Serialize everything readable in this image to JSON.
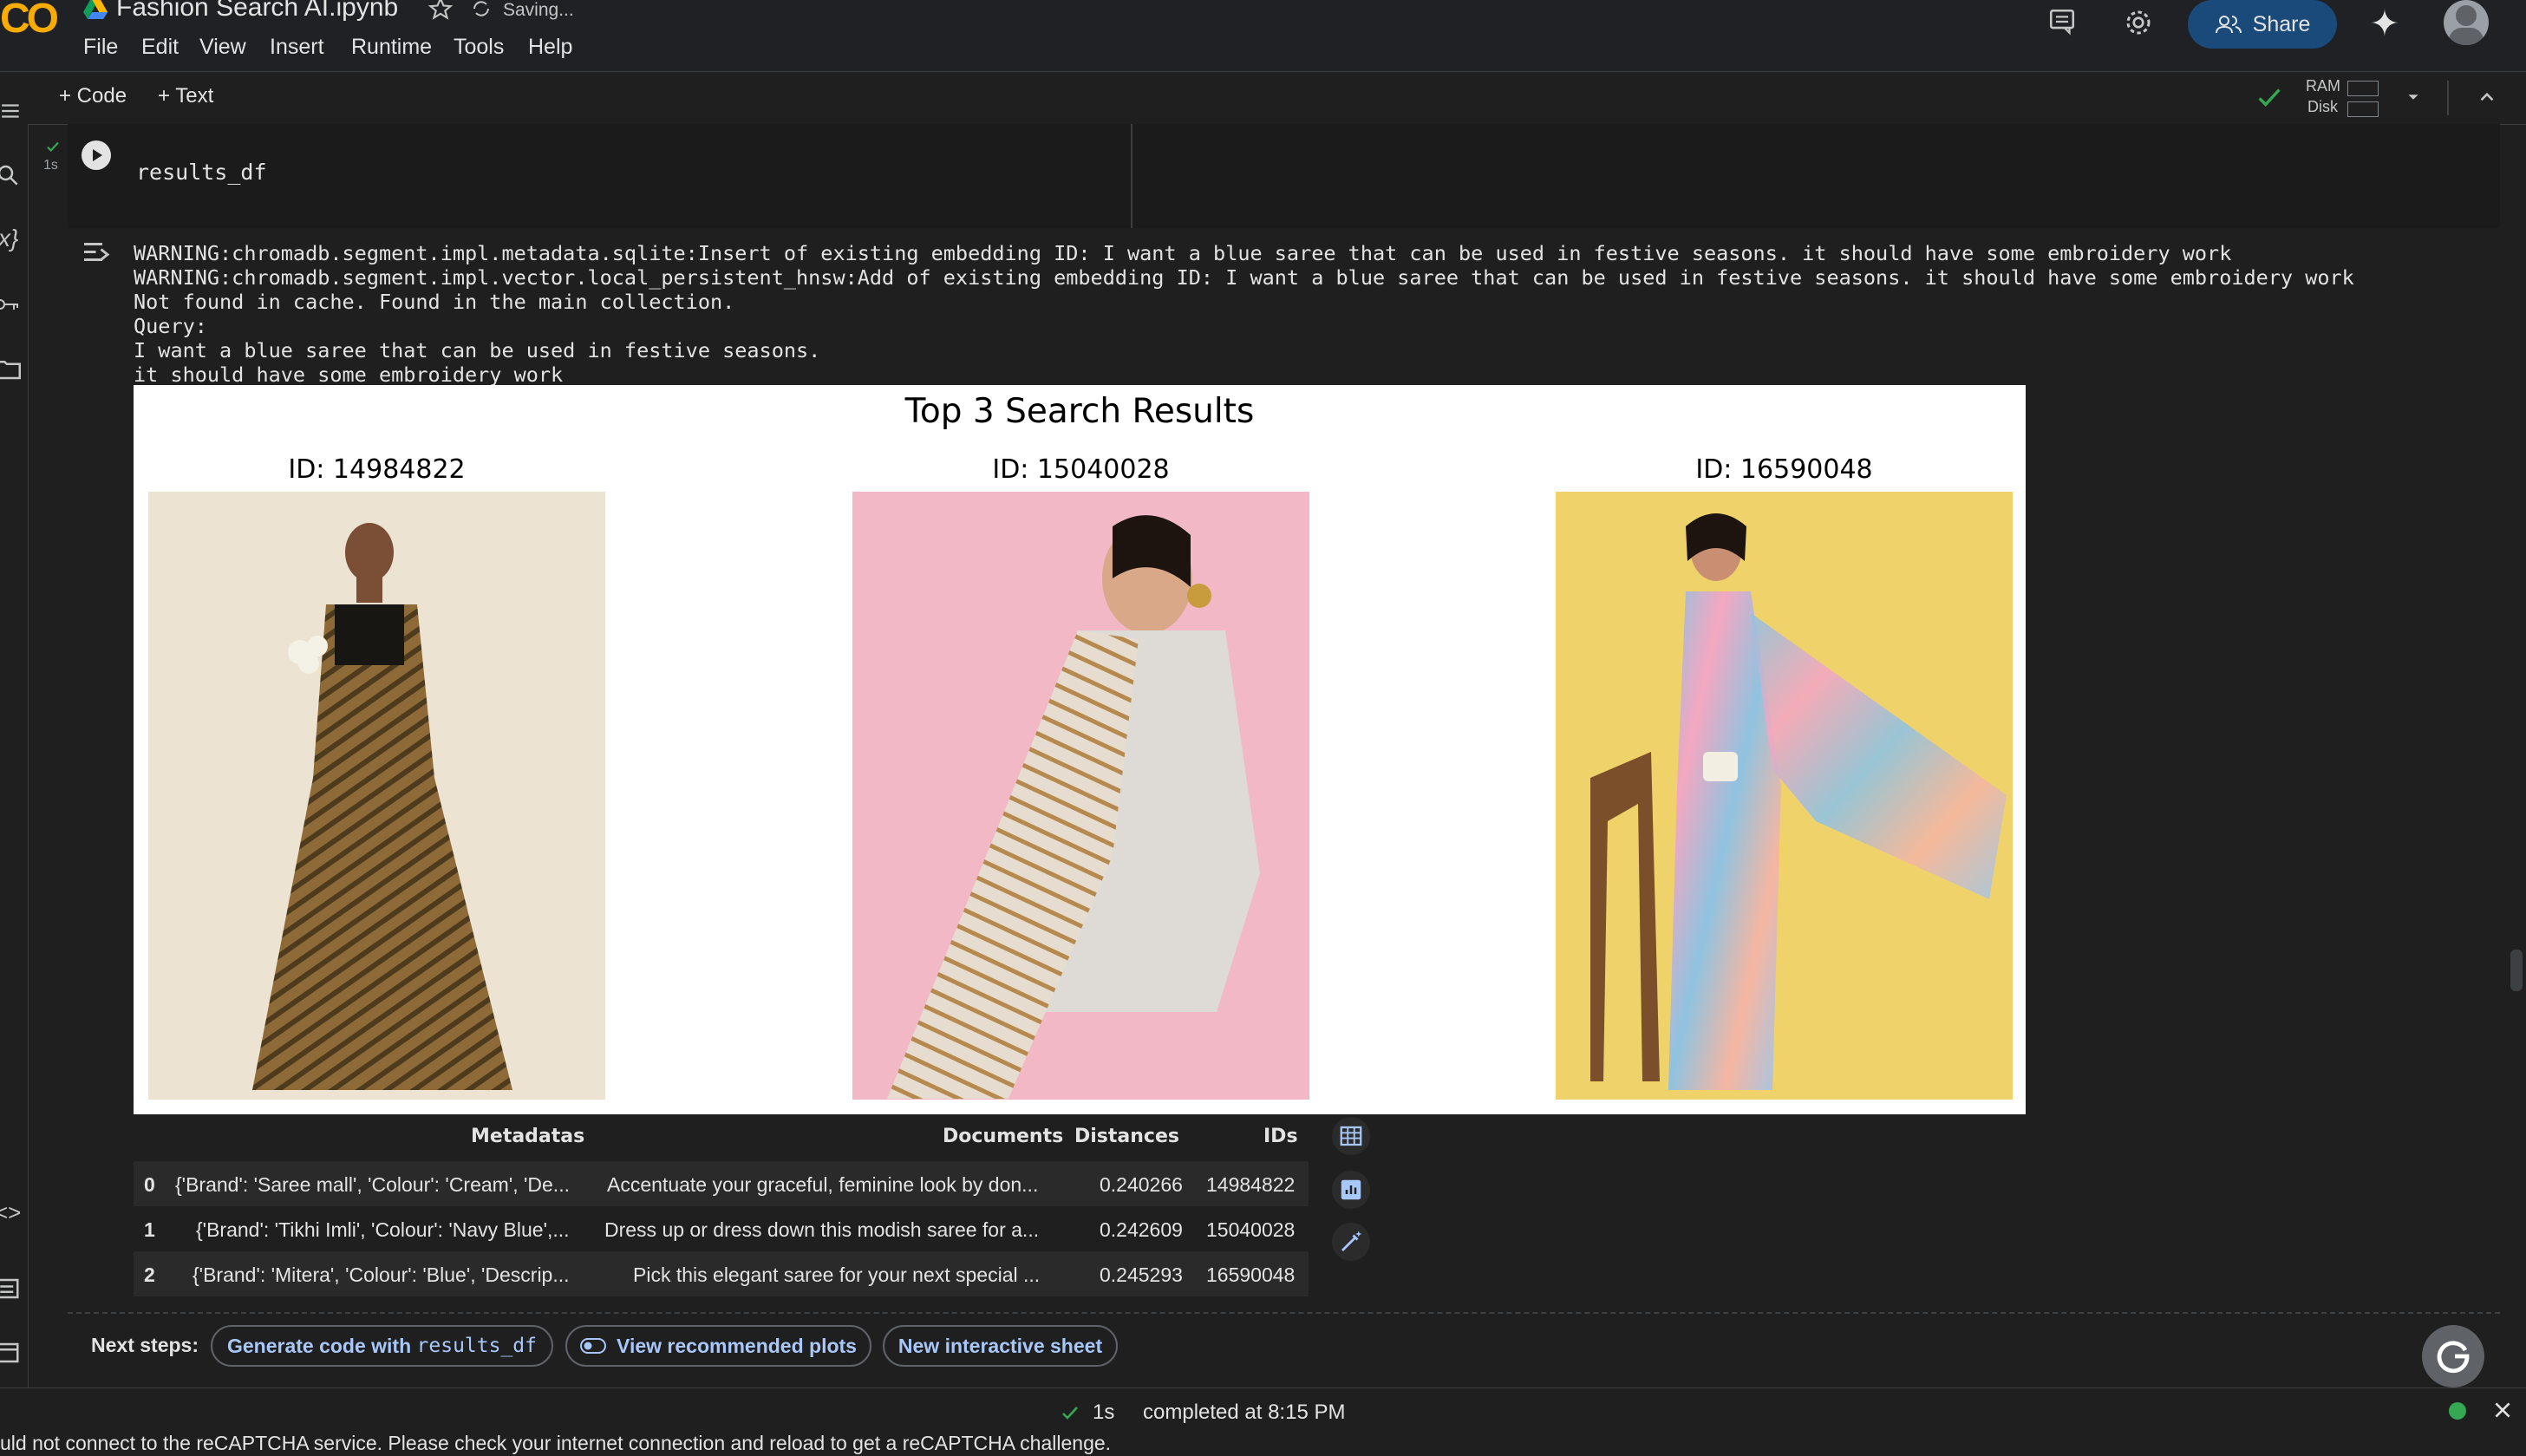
{
  "app": {
    "logo_text": "CO",
    "notebook_title": "Fashion Search AI.ipynb",
    "save_status": "Saving...",
    "menu": [
      "File",
      "Edit",
      "View",
      "Insert",
      "Runtime",
      "Tools",
      "Help"
    ],
    "share_label": "Share"
  },
  "toolbar": {
    "add_code": "+ Code",
    "add_text": "+ Text",
    "ram_label": "RAM",
    "disk_label": "Disk"
  },
  "cell": {
    "exec_time": "1s",
    "code": "results_df"
  },
  "output": {
    "lines": [
      "WARNING:chromadb.segment.impl.metadata.sqlite:Insert of existing embedding ID: I want a blue saree that can be used in festive seasons. it should have some embroidery work",
      "WARNING:chromadb.segment.impl.vector.local_persistent_hnsw:Add of existing embedding ID: I want a blue saree that can be used in festive seasons. it should have some embroidery work",
      "Not found in cache. Found in the main collection.",
      "Query:",
      "I want a blue saree that can be used in festive seasons.",
      "it should have some embroidery work"
    ]
  },
  "figure": {
    "title": "Top 3 Search Results",
    "items": [
      {
        "label": "ID: 14984822",
        "bg": "#ece3d2",
        "saree": "#8d6a38"
      },
      {
        "label": "ID: 15040028",
        "bg": "#f2b8c6",
        "saree": "#d9c7b1"
      },
      {
        "label": "ID: 16590048",
        "bg": "#efd36a",
        "saree": "#8fc3e0"
      }
    ]
  },
  "table": {
    "headers": [
      "Metadatas",
      "Documents",
      "Distances",
      "IDs"
    ],
    "rows": [
      {
        "index": "0",
        "metadata": "{'Brand': 'Saree mall', 'Colour': 'Cream', 'De...",
        "document": "Accentuate your graceful, feminine look by don...",
        "distance": "0.240266",
        "id": "14984822"
      },
      {
        "index": "1",
        "metadata": "{'Brand': 'Tikhi Imli', 'Colour': 'Navy Blue',...",
        "document": "Dress up or dress down this modish saree for a...",
        "distance": "0.242609",
        "id": "15040028"
      },
      {
        "index": "2",
        "metadata": "{'Brand': 'Mitera', 'Colour': 'Blue', 'Descrip...",
        "document": "Pick this elegant saree for your next special ...",
        "distance": "0.245293",
        "id": "16590048"
      }
    ]
  },
  "next_steps": {
    "label": "Next steps:",
    "chip1_prefix": "Generate code with ",
    "chip1_code": "results_df",
    "chip2": "View recommended plots",
    "chip3": "New interactive sheet"
  },
  "status": {
    "duration": "1s",
    "completed": "completed at 8:15 PM",
    "recaptcha": "uld not connect to the reCAPTCHA service. Please check your internet connection and reload to get a reCAPTCHA challenge."
  },
  "colors": {
    "background": "#1f1f1f",
    "accent": "#a8c7fa",
    "share_bg": "#1a4a7a",
    "success": "#34a853"
  }
}
